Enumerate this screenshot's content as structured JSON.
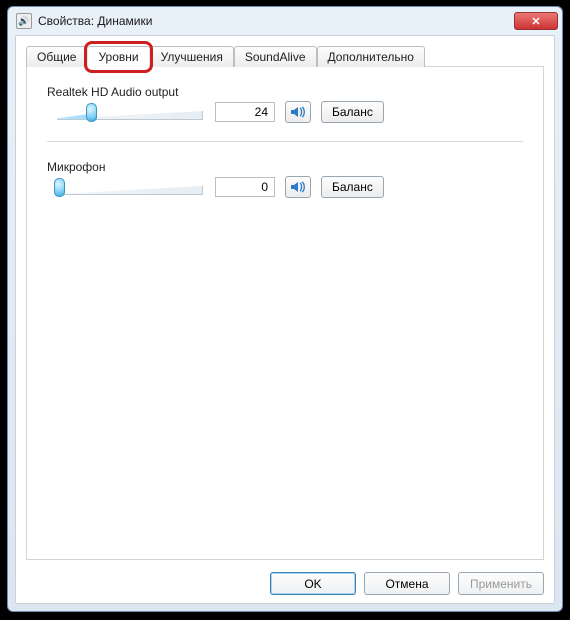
{
  "window": {
    "title": "Свойства: Динамики"
  },
  "tabs": {
    "items": [
      {
        "label": "Общие"
      },
      {
        "label": "Уровни"
      },
      {
        "label": "Улучшения"
      },
      {
        "label": "SoundAlive"
      },
      {
        "label": "Дополнительно"
      }
    ],
    "active_index": 1
  },
  "levels": {
    "channels": [
      {
        "name": "Realtek HD Audio output",
        "value": 24,
        "balance_label": "Баланс",
        "mute_icon": "speaker-icon"
      },
      {
        "name": "Микрофон",
        "value": 0,
        "balance_label": "Баланс",
        "mute_icon": "speaker-icon"
      }
    ]
  },
  "footer": {
    "ok": "OK",
    "cancel": "Отмена",
    "apply": "Применить"
  },
  "colors": {
    "highlight": "#cc2020",
    "accent": "#3c7fb1"
  }
}
